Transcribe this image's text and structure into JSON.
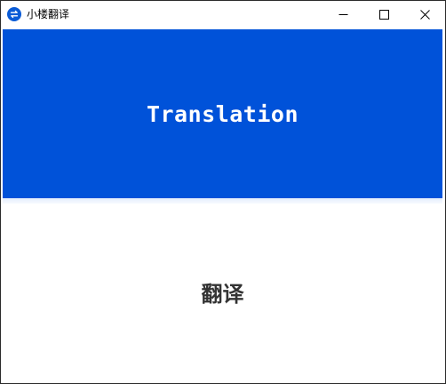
{
  "window": {
    "title": "小楼翻译",
    "app_icon": "translate-swap-icon",
    "controls": {
      "minimize_icon": "minimize-icon",
      "maximize_icon": "maximize-icon",
      "close_icon": "close-icon"
    }
  },
  "header": {
    "title": "Translation"
  },
  "content": {
    "text": "翻译"
  },
  "colors": {
    "accent": "#0052d9",
    "content_text": "#333333",
    "icon_bg": "#0a5bd6"
  }
}
